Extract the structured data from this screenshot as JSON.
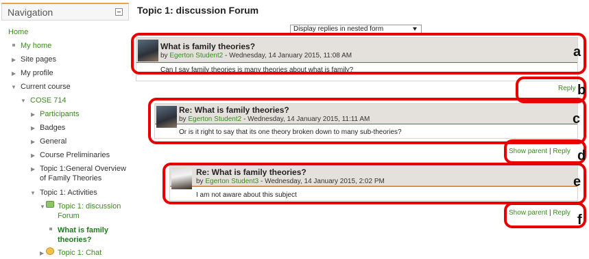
{
  "navigation": {
    "title": "Navigation",
    "home": "Home",
    "my_home": "My home",
    "site_pages": "Site pages",
    "my_profile": "My profile",
    "current_course": "Current course",
    "course_code": "COSE 714",
    "participants": "Participants",
    "badges": "Badges",
    "general": "General",
    "course_preliminaries": "Course Preliminaries",
    "topic1_overview_line1": "Topic 1:General Overview",
    "topic1_overview_line2": "of Family Theories",
    "topic1_activities": "Topic 1: Activities",
    "discussion_forum_line1": "Topic 1: discussion",
    "discussion_forum_line2": "Forum",
    "current_post_line1": "What is family",
    "current_post_line2": "theories?",
    "chat": "Topic 1: Chat"
  },
  "page_title": "Topic 1: discussion Forum",
  "display_mode": {
    "selected": "Display replies in nested form"
  },
  "posts": [
    {
      "subject": "What is family theories?",
      "by": "by",
      "author": "Egerton Student2",
      "date": " - Wednesday, 14 January 2015, 11:08 AM",
      "body": "Can I say family theories is many theories about what is family?"
    },
    {
      "subject": "Re: What is family theories?",
      "by": "by",
      "author": "Egerton Student2",
      "date": " - Wednesday, 14 January 2015, 11:11 AM",
      "body": "Or is it right to say that its one theory broken down to many sub-theories?"
    },
    {
      "subject": "Re: What is family theories?",
      "by": "by",
      "author": "Egerton Student3",
      "date": " - Wednesday, 14 January 2015, 2:02 PM",
      "body": "I am not aware about this subject"
    }
  ],
  "links": {
    "reply": "Reply",
    "show_parent": "Show parent",
    "separator": "|"
  },
  "annotations": [
    "a",
    "b",
    "c",
    "d",
    "e",
    "f"
  ],
  "colors": {
    "annotation": "#e80000",
    "link": "#3a8a1e",
    "accent": "#f0a13a",
    "post_header": "#e4e1dc"
  }
}
